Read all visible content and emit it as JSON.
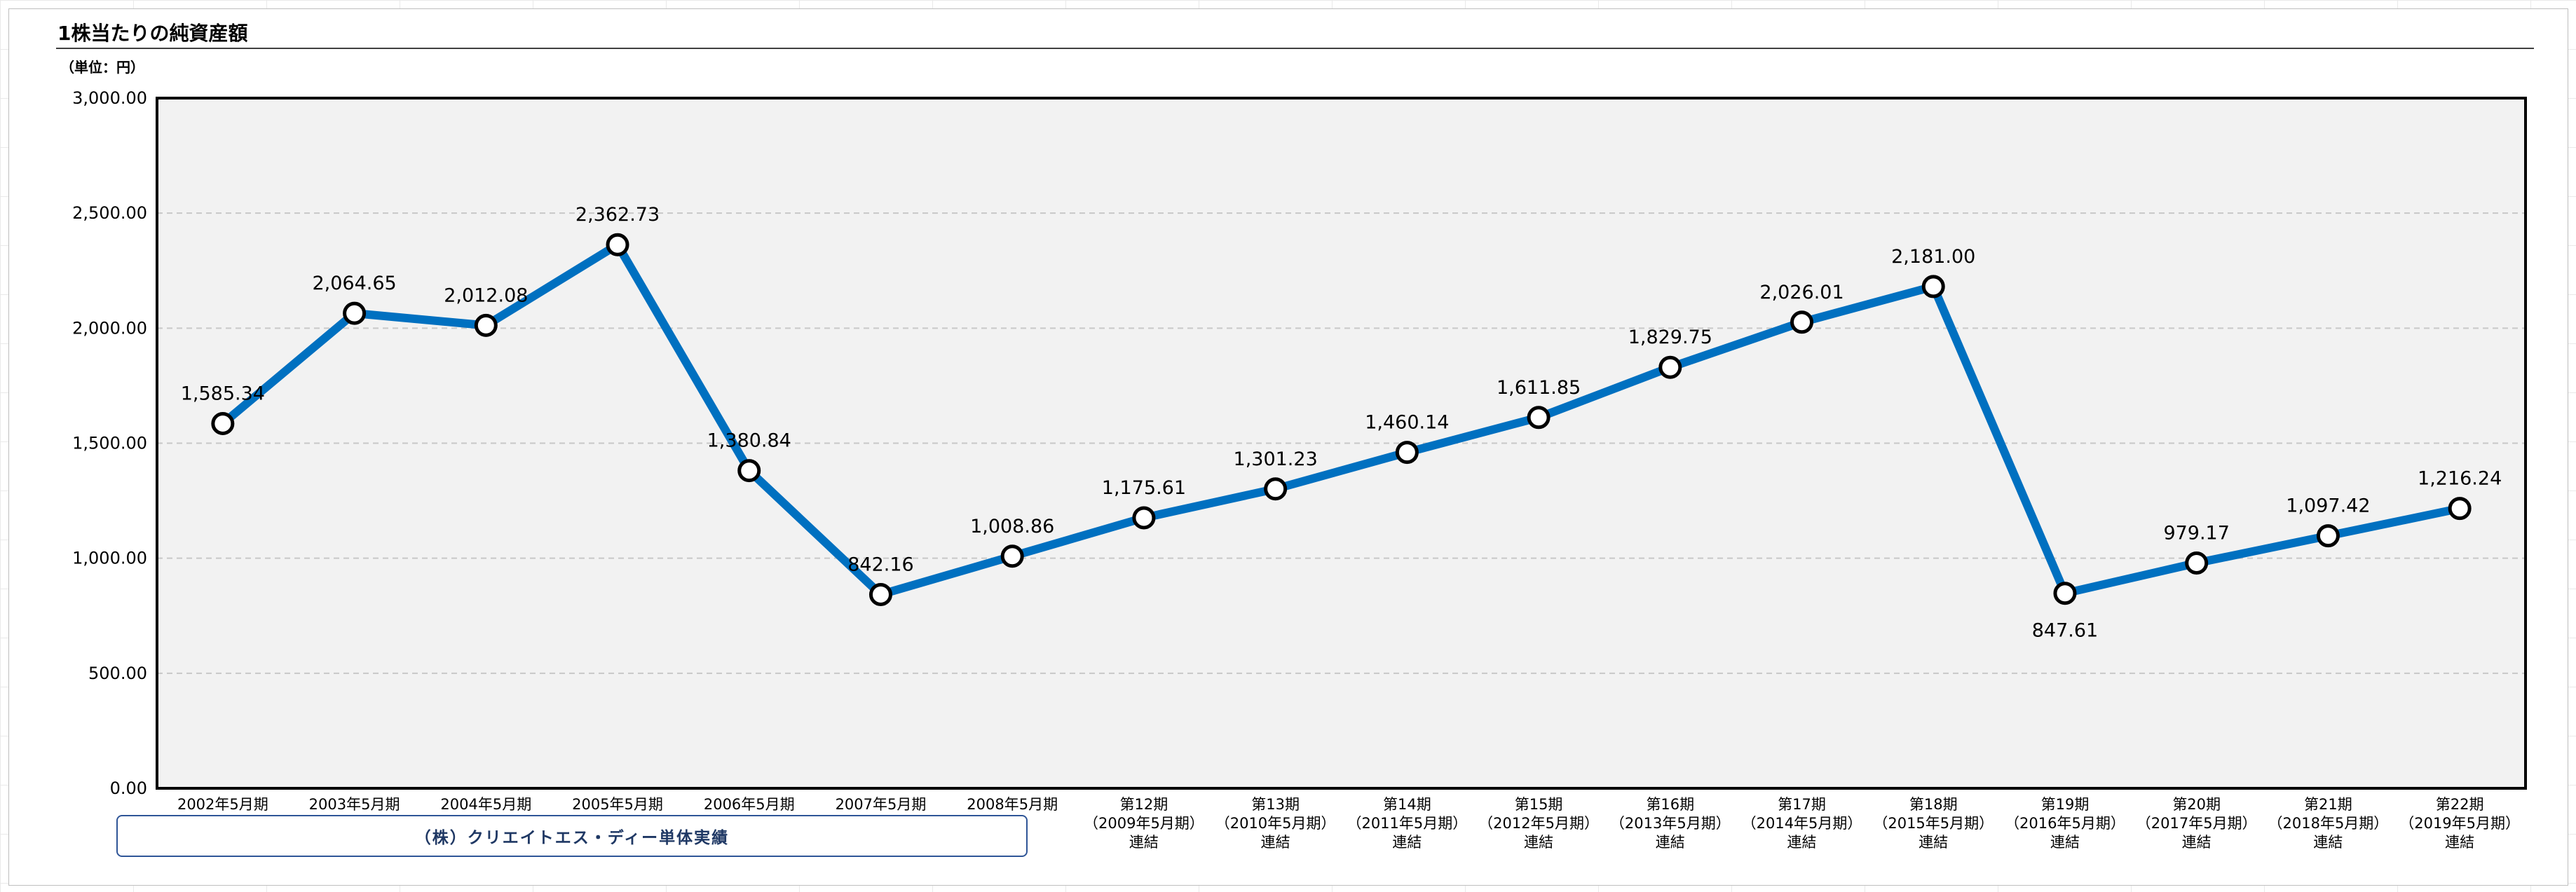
{
  "title": "1株当たりの純資産額",
  "unit_label": "（単位：円）",
  "company_label": "（株）クリエイトエス・ディー単体実績",
  "colors": {
    "line": "#0070c0",
    "plot_bg": "#f2f2f2",
    "marker_fill": "#ffffff",
    "marker_stroke": "#000000"
  },
  "chart_data": {
    "type": "line",
    "title": "1株当たりの純資産額",
    "ylabel": "（単位：円）",
    "ylim": [
      0,
      3000
    ],
    "grid": true,
    "y_ticks": [
      "0.00",
      "500.00",
      "1,000.00",
      "1,500.00",
      "2,000.00",
      "2,500.00",
      "3,000.00"
    ],
    "y_tick_values": [
      0,
      500,
      1000,
      1500,
      2000,
      2500,
      3000
    ],
    "categories": [
      [
        "2002年5月期"
      ],
      [
        "2003年5月期"
      ],
      [
        "2004年5月期"
      ],
      [
        "2005年5月期"
      ],
      [
        "2006年5月期"
      ],
      [
        "2007年5月期"
      ],
      [
        "2008年5月期"
      ],
      [
        "第12期",
        "（2009年5月期）",
        "連結"
      ],
      [
        "第13期",
        "（2010年5月期）",
        "連結"
      ],
      [
        "第14期",
        "（2011年5月期）",
        "連結"
      ],
      [
        "第15期",
        "（2012年5月期）",
        "連結"
      ],
      [
        "第16期",
        "（2013年5月期）",
        "連結"
      ],
      [
        "第17期",
        "（2014年5月期）",
        "連結"
      ],
      [
        "第18期",
        "（2015年5月期）",
        "連結"
      ],
      [
        "第19期",
        "（2016年5月期）",
        "連結"
      ],
      [
        "第20期",
        "（2017年5月期）",
        "連結"
      ],
      [
        "第21期",
        "（2018年5月期）",
        "連結"
      ],
      [
        "第22期",
        "（2019年5月期）",
        "連結"
      ]
    ],
    "values": [
      1585.34,
      2064.65,
      2012.08,
      2362.73,
      1380.84,
      842.16,
      1008.86,
      1175.61,
      1301.23,
      1460.14,
      1611.85,
      1829.75,
      2026.01,
      2181.0,
      847.61,
      979.17,
      1097.42,
      1216.24
    ],
    "data_labels": [
      "1,585.34",
      "2,064.65",
      "2,012.08",
      "2,362.73",
      "1,380.84",
      "842.16",
      "1,008.86",
      "1,175.61",
      "1,301.23",
      "1,460.14",
      "1,611.85",
      "1,829.75",
      "2,026.01",
      "2,181.00",
      "847.61",
      "979.17",
      "1,097.42",
      "1,216.24"
    ],
    "label_position": [
      "above",
      "above",
      "above",
      "above",
      "above",
      "above",
      "above",
      "above",
      "above",
      "above",
      "above",
      "above",
      "above",
      "above",
      "below",
      "above",
      "above",
      "above"
    ]
  }
}
